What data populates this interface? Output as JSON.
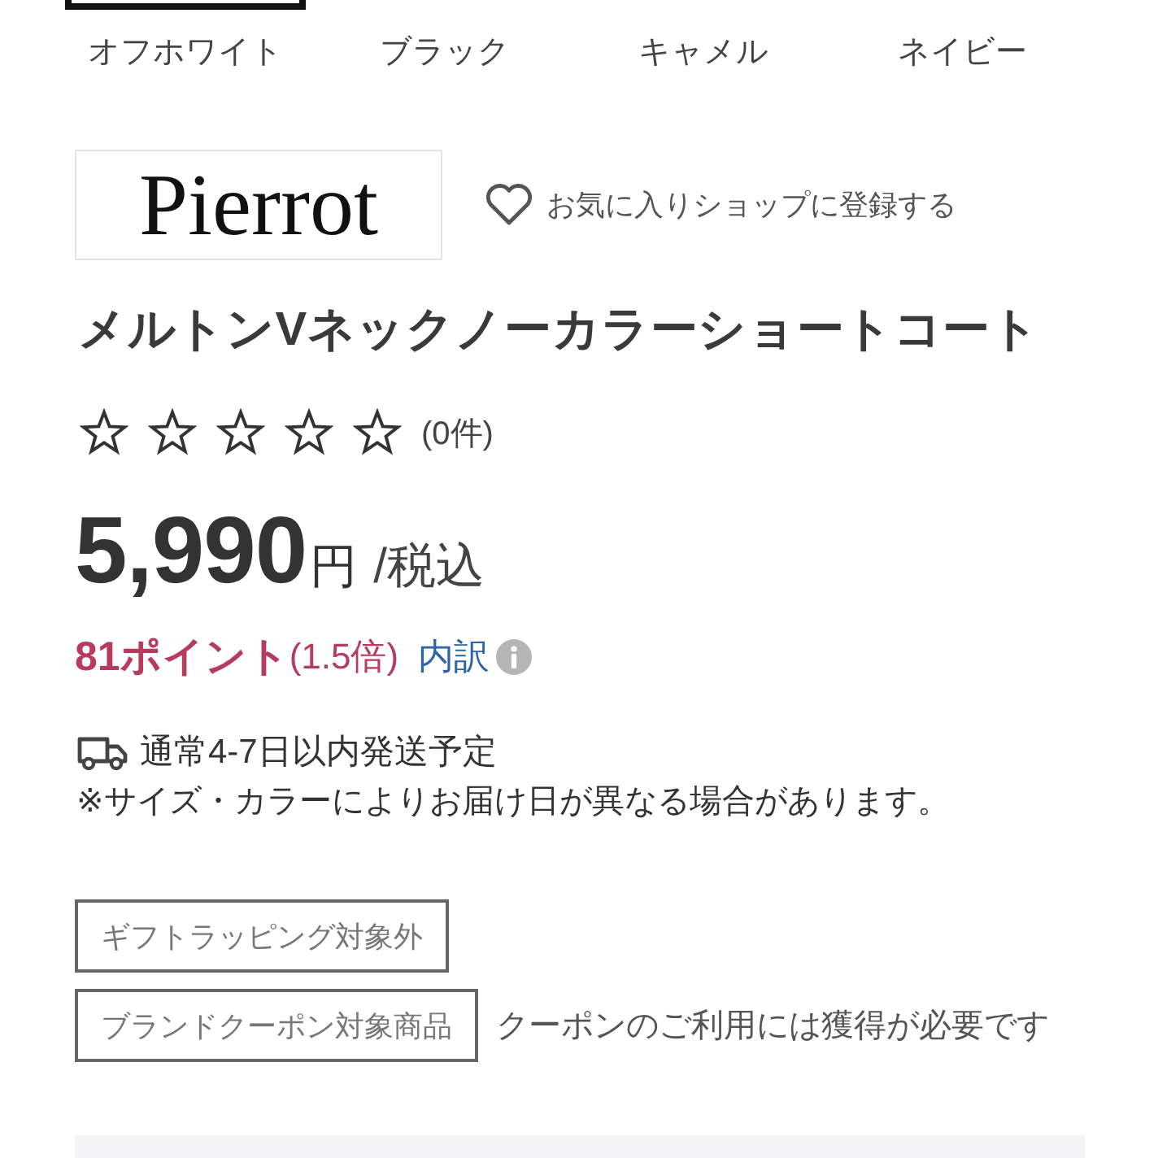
{
  "colors": [
    {
      "label": "オフホワイト",
      "selected": true
    },
    {
      "label": "ブラック",
      "selected": false
    },
    {
      "label": "キャメル",
      "selected": false
    },
    {
      "label": "ネイビー",
      "selected": false
    }
  ],
  "shop": {
    "logo": "Pierrot",
    "favorite_label": "お気に入りショップに登録する"
  },
  "product": {
    "title": "メルトンVネックノーカラーショートコート",
    "stars": 0,
    "review_count": "(0件)"
  },
  "price": {
    "amount": "5,990",
    "currency": "円",
    "tax_note": "/税込"
  },
  "points": {
    "earned": "81ポイント",
    "multiplier": "(1.5倍)",
    "breakdown_link": "内訳"
  },
  "shipping": {
    "estimate": "通常4-7日以内発送予定",
    "note": "※サイズ・カラーによりお届け日が異なる場合があります。"
  },
  "tags": [
    {
      "label": "ギフトラッピング対象外"
    },
    {
      "label": "ブランドクーポン対象商品",
      "note": "クーポンのご利用には獲得が必要です"
    }
  ]
}
